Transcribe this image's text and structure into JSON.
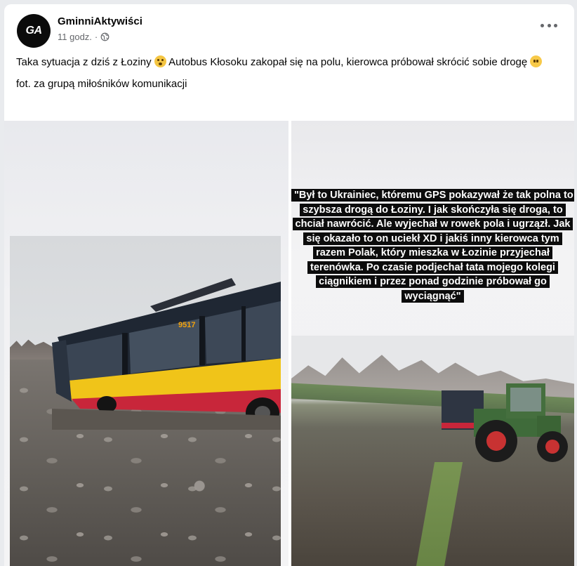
{
  "post": {
    "author": "GminniAktywiści",
    "avatar_text": "GA",
    "time": "11 godz.",
    "separator": "·",
    "text_line1_a": "Taka sytuacja z dziś z Łoziny",
    "text_line1_b": "Autobus Kłosoku zakopał się na polu, kierowca próbował skrócić sobie drogę",
    "text_line2": "fot. za grupą miłośników komunikacji"
  },
  "photos": {
    "overlay_text": "\"Był to Ukrainiec, któremu GPS pokazywał że tak polna to szybsza drogą do Łoziny. I jak skończyła się droga, to chciał nawrócić. Ale wyjechał w rowek pola i ugrzązł. Jak się okazało to on uciekł XD i jakiś inny kierowca tym razem Polak, który mieszka w Łozinie przyjechał terenówka. Po czasie podjechał tata mojego kolegi ciągnikiem i przez ponad godzinie próbował go wyciągnąć\"",
    "bus_number": "9517"
  },
  "icons": {
    "globe": "globe-icon",
    "more": "more-options-icon",
    "emoji1": "flushed-face-emoji",
    "emoji2": "neutral-face-emoji"
  },
  "colors": {
    "bus_yellow": "#f0c419",
    "bus_red": "#c8263a",
    "tractor_green": "#3f6b3a"
  }
}
